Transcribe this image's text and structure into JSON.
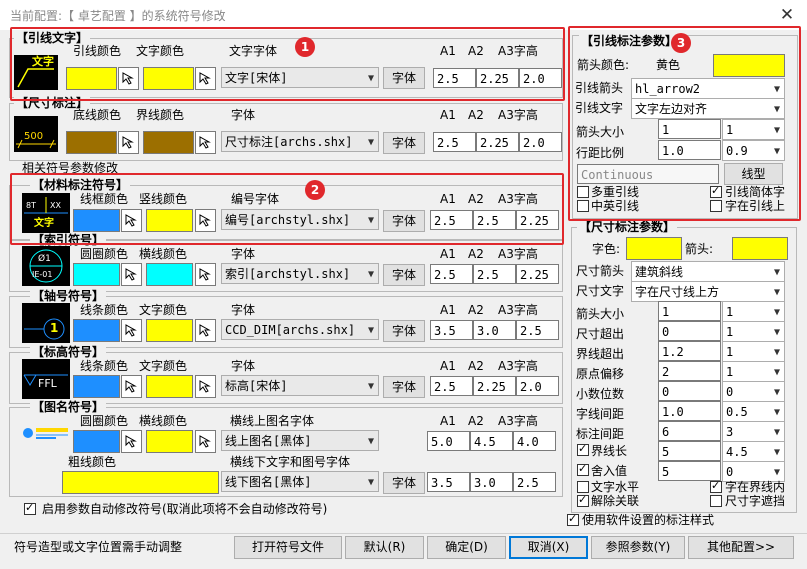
{
  "window": {
    "title": "当前配置:【 卓艺配置 】的系统符号修改"
  },
  "colors": {
    "yellow": "#ffff00",
    "brown": "#9c6f00",
    "blue": "#1e8fff",
    "cyan": "#00ffff"
  },
  "leader_text": {
    "title": "【引线文字】",
    "line_color": "引线颜色",
    "text_color": "文字颜色",
    "font": "文字字体",
    "font_value": "文字[宋体]",
    "font_btn": "字体",
    "a1": "A1",
    "a2": "A2",
    "a3": "A3字高",
    "v1": "2.5",
    "v2": "2.25",
    "v3": "2.0"
  },
  "dimension": {
    "title": "【尺寸标注】",
    "line_color": "底线颜色",
    "bound_color": "界线颜色",
    "font": "字体",
    "font_value": "尺寸标注[archs.shx]",
    "font_btn": "字体",
    "a1": "A1",
    "a2": "A2",
    "a3": "A3字高",
    "v1": "2.5",
    "v2": "2.25",
    "v3": "2.0"
  },
  "related_title": "相关符号参数修改",
  "material": {
    "title": "【材料标注符号】",
    "frame_color": "线框颜色",
    "vline_color": "竖线颜色",
    "font": "编号字体",
    "font_value": "编号[archstyl.shx]",
    "font_btn": "字体",
    "a1": "A1",
    "a2": "A2",
    "a3": "A3字高",
    "v1": "2.5",
    "v2": "2.5",
    "v3": "2.25"
  },
  "index": {
    "title": "【索引符号】",
    "circle_color": "圆圈颜色",
    "hline_color": "横线颜色",
    "font": "字体",
    "font_value": "索引[archstyl.shx]",
    "font_btn": "字体",
    "a1": "A1",
    "a2": "A2",
    "a3": "A3字高",
    "v1": "2.5",
    "v2": "2.5",
    "v3": "2.25"
  },
  "axis": {
    "title": "【轴号符号】",
    "line_color": "线条颜色",
    "text_color": "文字颜色",
    "font": "字体",
    "font_value": "CCD_DIM[archs.shx]",
    "font_btn": "字体",
    "a1": "A1",
    "a2": "A2",
    "a3": "A3字高",
    "v1": "3.5",
    "v2": "3.0",
    "v3": "2.5"
  },
  "elevation": {
    "title": "【标高符号】",
    "line_color": "线条颜色",
    "text_color": "文字颜色",
    "font": "字体",
    "font_value": "标高[宋体]",
    "font_btn": "字体",
    "a1": "A1",
    "a2": "A2",
    "a3": "A3字高",
    "v1": "2.5",
    "v2": "2.25",
    "v3": "2.0"
  },
  "drawing_name": {
    "title": "【图名符号】",
    "circle_color": "圆圈颜色",
    "hline_color": "横线颜色",
    "font_upper": "横线上图名字体",
    "font_upper_value": "线上图名[黑体]",
    "bold_color": "粗线颜色",
    "font_lower": "横线下文字和图号字体",
    "font_lower_value": "线下图名[黑体]",
    "font_btn": "字体",
    "a1": "A1",
    "a2": "A2",
    "a3": "A3字高",
    "v1": "5.0",
    "v2": "4.5",
    "v3": "4.0",
    "w1": "3.5",
    "w2": "3.0",
    "w3": "2.5"
  },
  "auto_modify": "启用参数自动修改符号(取消此项将不会自动修改符号)",
  "leader_params": {
    "title": "【引线标注参数】",
    "arrow_color": "箭头颜色:",
    "arrow_color_value": "黄色",
    "arrow": "引线箭头",
    "arrow_value": "hl_arrow2",
    "text": "引线文字",
    "text_value": "文字左边对齐",
    "arrow_size": "箭头大小",
    "arrow_size_value": "1",
    "arrow_size_sel": "1",
    "line_spacing": "行距比例",
    "line_spacing_value": "1.0",
    "line_spacing_sel": "0.9",
    "linetype_value": "Continuous",
    "linetype_btn": "线型",
    "multi": "多重引线",
    "simple": "引线简体字",
    "mid": "中英引线",
    "on_line": "字在引线上"
  },
  "dim_params": {
    "title": "【尺寸标注参数】",
    "text_color": "字色:",
    "arrow_color": "箭头:",
    "arrow": "尺寸箭头",
    "arrow_value": "建筑斜线",
    "text": "尺寸文字",
    "text_value": "字在尺寸线上方",
    "rows": [
      {
        "label": "箭头大小",
        "value": "1",
        "sel": "1"
      },
      {
        "label": "尺寸超出",
        "value": "0",
        "sel": "1"
      },
      {
        "label": "界线超出",
        "value": "1.2",
        "sel": "1"
      },
      {
        "label": "原点偏移",
        "value": "2",
        "sel": "1"
      },
      {
        "label": "小数位数",
        "value": "0",
        "sel": "0"
      },
      {
        "label": "字线间距",
        "value": "1.0",
        "sel": "0.5"
      },
      {
        "label": "标注间距",
        "value": "6",
        "sel": "3"
      },
      {
        "label": "界线长",
        "value": "5",
        "sel": "4.5"
      },
      {
        "label": "舍入值",
        "value": "5",
        "sel": "0"
      }
    ],
    "text_h": "文字水平",
    "text_in": "字在界线内",
    "release": "解除关联",
    "cover": "尺寸字遮挡",
    "use_software": "使用软件设置的标注样式"
  },
  "footer": {
    "hint": "符号造型或文字位置需手动调整",
    "open": "打开符号文件",
    "default": "默认(R)",
    "ok": "确定(D)",
    "cancel": "取消(X)",
    "ref": "参照参数(Y)",
    "more": "其他配置>>"
  },
  "badges": {
    "b1": "1",
    "b2": "2",
    "b3": "3"
  },
  "preview": {
    "leader": "文字",
    "dim": "500",
    "mat1": "8T",
    "mat2": "XX",
    "mat3": "文字",
    "index1": "Ø1",
    "index2": "IE-01",
    "axis": "1",
    "elev": "FFL"
  }
}
